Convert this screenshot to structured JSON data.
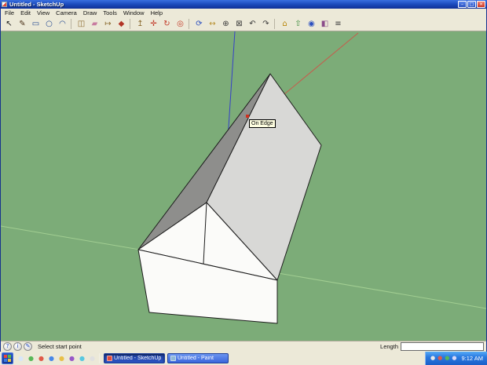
{
  "titlebar": {
    "title": "Untitled - SketchUp",
    "minimize_glyph": "–",
    "maximize_glyph": "□",
    "close_glyph": "×"
  },
  "menubar": {
    "items": [
      {
        "name": "menu-file",
        "label": "File"
      },
      {
        "name": "menu-edit",
        "label": "Edit"
      },
      {
        "name": "menu-view",
        "label": "View"
      },
      {
        "name": "menu-camera",
        "label": "Camera"
      },
      {
        "name": "menu-draw",
        "label": "Draw"
      },
      {
        "name": "menu-tools",
        "label": "Tools"
      },
      {
        "name": "menu-window",
        "label": "Window"
      },
      {
        "name": "menu-help",
        "label": "Help"
      }
    ]
  },
  "toolbar": {
    "icons": [
      {
        "name": "select-tool",
        "glyph": "↖",
        "color": "#1a1a1a"
      },
      {
        "name": "line-tool",
        "glyph": "✎",
        "color": "#4a3018"
      },
      {
        "name": "rectangle-tool",
        "glyph": "▭",
        "color": "#1f4690"
      },
      {
        "name": "circle-tool",
        "glyph": "○",
        "color": "#1f4690"
      },
      {
        "name": "arc-tool",
        "glyph": "◠",
        "color": "#1f4690"
      },
      {
        "separator": true
      },
      {
        "name": "make-component-tool",
        "glyph": "◫",
        "color": "#8a6a2f"
      },
      {
        "name": "eraser-tool",
        "glyph": "▰",
        "color": "#c87ca0"
      },
      {
        "name": "tape-measure-tool",
        "glyph": "↦",
        "color": "#8a6a2f"
      },
      {
        "name": "paint-bucket-tool",
        "glyph": "◆",
        "color": "#b23527"
      },
      {
        "separator": true
      },
      {
        "name": "push-pull-tool",
        "glyph": "↥",
        "color": "#8a6a2f"
      },
      {
        "name": "move-tool",
        "glyph": "✛",
        "color": "#c23a28"
      },
      {
        "name": "rotate-tool",
        "glyph": "↻",
        "color": "#c23a28"
      },
      {
        "name": "offset-tool",
        "glyph": "◎",
        "color": "#c23a28"
      },
      {
        "separator": true
      },
      {
        "name": "orbit-tool",
        "glyph": "⟳",
        "color": "#2b4fc0"
      },
      {
        "name": "pan-tool",
        "glyph": "↔",
        "color": "#b8902f"
      },
      {
        "name": "zoom-tool",
        "glyph": "⊕",
        "color": "#3a3a3a"
      },
      {
        "name": "zoom-extents-tool",
        "glyph": "⊠",
        "color": "#3a3a3a"
      },
      {
        "name": "previous-view-tool",
        "glyph": "↶",
        "color": "#3a3a3a"
      },
      {
        "name": "next-view-tool",
        "glyph": "↷",
        "color": "#3a3a3a"
      },
      {
        "separator": true
      },
      {
        "name": "get-models-tool",
        "glyph": "⌂",
        "color": "#b8860b"
      },
      {
        "name": "share-models-tool",
        "glyph": "⇧",
        "color": "#3a8a3a"
      },
      {
        "name": "model-info-button",
        "glyph": "◉",
        "color": "#2b4fc0"
      },
      {
        "name": "materials-button",
        "glyph": "◧",
        "color": "#8a4a8a"
      },
      {
        "name": "layers-button",
        "glyph": "≡",
        "color": "#3a3a3a"
      }
    ]
  },
  "viewport": {
    "tooltip_label": "On Edge",
    "colors": {
      "background": "#7CAC78",
      "roof_light": "#D8D8D6",
      "roof_dark": "#8E8E8C",
      "face_white": "#FBFBF9",
      "edge": "#1c1c1c",
      "axis_red": "#C75B4C",
      "axis_green": "#A2CE92",
      "axis_blue": "#3640C8",
      "inference_red": "#D03020"
    }
  },
  "statusbar": {
    "icons": [
      {
        "name": "help-status-icon",
        "glyph": "?"
      },
      {
        "name": "credits-status-icon",
        "glyph": "i"
      },
      {
        "name": "instructor-status-icon",
        "glyph": "✎"
      }
    ],
    "message": "Select start point",
    "length_label": "Length",
    "length_value": ""
  },
  "taskbar": {
    "start_flag_colors": [
      "#e8483c",
      "#58b848",
      "#3878e0",
      "#e8c040"
    ],
    "quick_launch": [
      {
        "name": "quick-launch-1",
        "glyph": "●",
        "color": "#d8e6f8"
      },
      {
        "name": "quick-launch-2",
        "glyph": "●",
        "color": "#58b858"
      },
      {
        "name": "quick-launch-3",
        "glyph": "●",
        "color": "#e05a48"
      },
      {
        "name": "quick-launch-4",
        "glyph": "●",
        "color": "#4888e8"
      },
      {
        "name": "quick-launch-5",
        "glyph": "●",
        "color": "#e8c048"
      },
      {
        "name": "quick-launch-6",
        "glyph": "●",
        "color": "#9858c8"
      },
      {
        "name": "quick-launch-7",
        "glyph": "●",
        "color": "#58c8e0"
      },
      {
        "name": "quick-launch-8",
        "glyph": "●",
        "color": "#e0e0e0"
      }
    ],
    "tasks": [
      {
        "name": "taskbar-button-sketchup",
        "label": "Untitled - SketchUp",
        "icon_color": "#e14b3c",
        "active": true
      },
      {
        "name": "taskbar-button-paint",
        "label": "Untitled - Paint",
        "icon_color": "#8fb8d8",
        "active": false
      }
    ],
    "tray_icons": [
      {
        "name": "tray-icon-1",
        "glyph": "●",
        "color": "#e8e8e8"
      },
      {
        "name": "tray-icon-2",
        "glyph": "●",
        "color": "#e05a48"
      },
      {
        "name": "tray-icon-3",
        "glyph": "●",
        "color": "#58b858"
      },
      {
        "name": "tray-icon-4",
        "glyph": "●",
        "color": "#d8d8f8"
      }
    ],
    "clock": "9:12 AM"
  }
}
